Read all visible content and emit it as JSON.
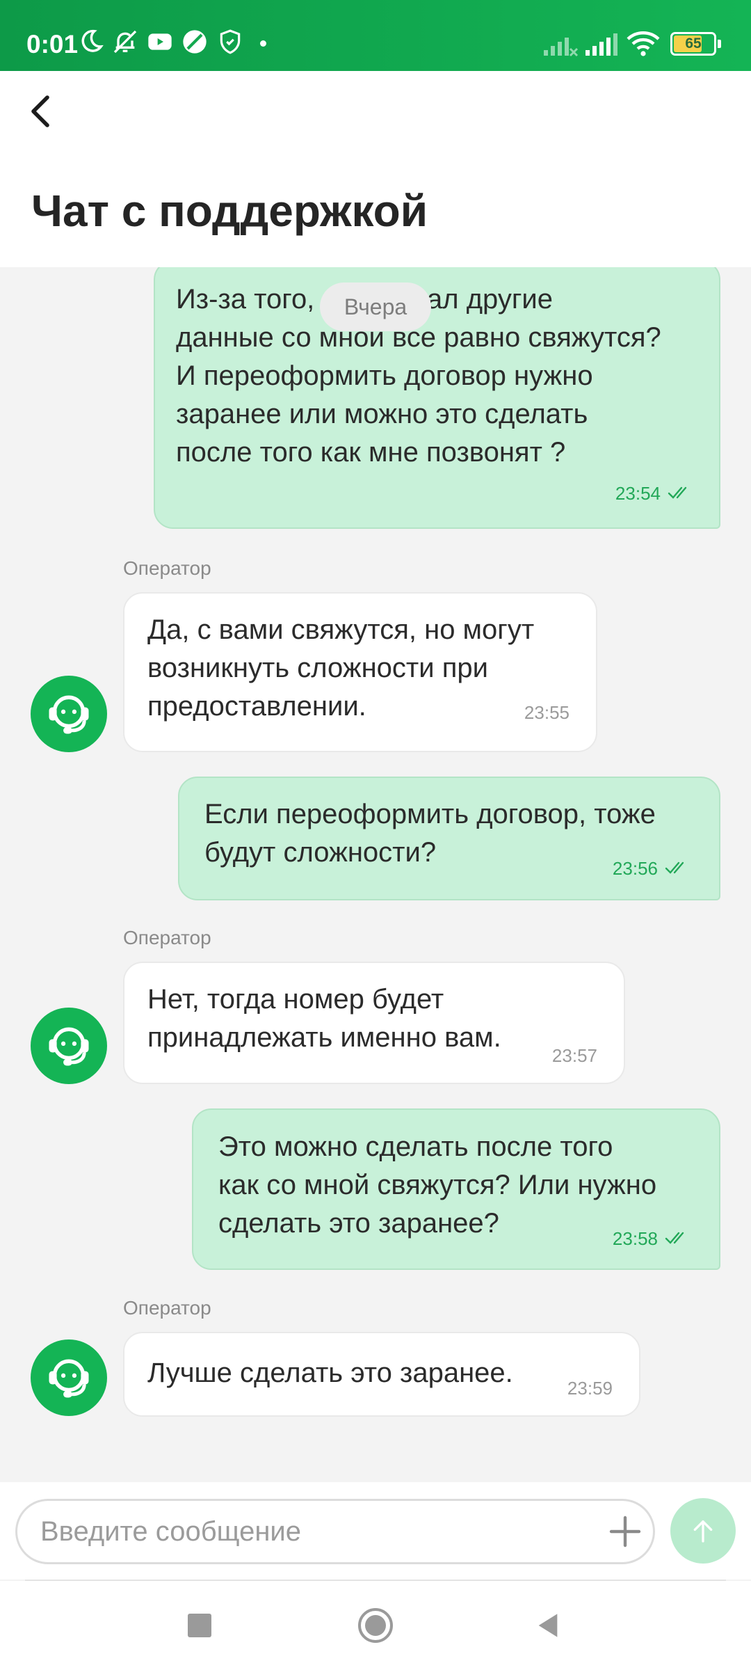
{
  "status_bar": {
    "time": "0:01",
    "battery": "65",
    "icons": [
      "moon-icon",
      "bell-off-icon",
      "youtube-icon",
      "leaf-icon",
      "shield-icon",
      "signal-icon",
      "wifi-icon",
      "battery-icon"
    ]
  },
  "header": {
    "title": "Чат с поддержкой",
    "back_icon": "chevron-left-icon"
  },
  "chat": {
    "date_separator": "Вчера",
    "operator_label": "Оператор",
    "messages": [
      {
        "from": "user",
        "text": "Из-за того, что указал другие\nданные со мной все равно свяжутся?\nИ переоформить договор нужно\nзаранее или можно это сделать\nпосле того как мне позвонят ?",
        "time": "23:54",
        "status": "read"
      },
      {
        "from": "operator",
        "text": "Да, с вами свяжутся, но могут\nвозникнуть сложности при\nпредоставлении.",
        "time": "23:55"
      },
      {
        "from": "user",
        "text": "Если переоформить договор, тоже\nбудут сложности?",
        "time": "23:56",
        "status": "read"
      },
      {
        "from": "operator",
        "text": "Нет, тогда номер будет\nпринадлежать именно вам.",
        "time": "23:57"
      },
      {
        "from": "user",
        "text": "Это можно сделать после того\nкак со мной свяжутся? Или нужно\nсделать это заранее?",
        "time": "23:58",
        "status": "read"
      },
      {
        "from": "operator",
        "text": "Лучше сделать это заранее.",
        "time": "23:59"
      }
    ]
  },
  "composer": {
    "placeholder": "Введите сообщение",
    "value": ""
  },
  "colors": {
    "brand": "#14b455",
    "outgoing_bubble": "#c8f1d9",
    "send_button_disabled": "#b8ebcd"
  }
}
